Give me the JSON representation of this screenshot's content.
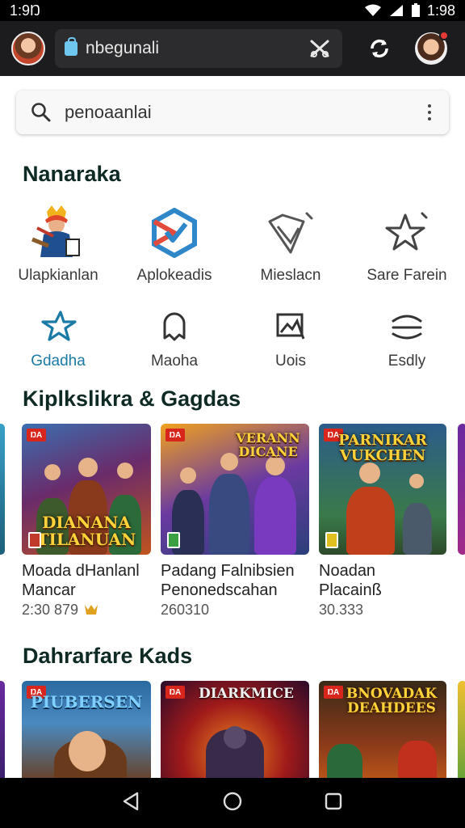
{
  "status": {
    "time": "1:9Ŋ",
    "time_right": "1:98"
  },
  "app_bar": {
    "search_text": "nbegunali",
    "close_icon": "close-icon",
    "sync_icon": "sync-icon"
  },
  "search": {
    "value": "penoaanlai"
  },
  "categories_section": {
    "title": "Nanaraka",
    "items": [
      {
        "label": "Ulapkianlan",
        "icon": "game-hero-icon"
      },
      {
        "label": "Aplokeadis",
        "icon": "apps-hex-icon"
      },
      {
        "label": "Mieslacn",
        "icon": "heart-tag-icon"
      },
      {
        "label": "Sare Farein",
        "icon": "star-icon"
      },
      {
        "label": "Gdadha",
        "icon": "plane-star-icon"
      },
      {
        "label": "Maoha",
        "icon": "ghost-icon"
      },
      {
        "label": "Uois",
        "icon": "image-frame-icon"
      },
      {
        "label": "Esdly",
        "icon": "waves-icon"
      }
    ]
  },
  "section1": {
    "title": "Kiplkslikra & Gagdas",
    "cards": [
      {
        "banner": "DIANANA\nTILANUAN",
        "line1": "Moada dHanlanl",
        "line2": "Mancar",
        "meta": "2:30 879",
        "badge": "ŊA",
        "has_award": true,
        "accent": "#7b2a1a"
      },
      {
        "banner": "VERANN\nDICANE",
        "line1": "Padang Falnibsien",
        "line2": "Penonedscahan",
        "meta": "260310",
        "badge": "ŊA",
        "has_award": false,
        "accent": "#4b2ea0"
      },
      {
        "banner": "PARNIKAR\nVUKCHEN",
        "line1": "Noadan",
        "line2": "Placainß",
        "meta": "30.333",
        "badge": "ŊA",
        "has_award": false,
        "accent": "#2b5c8a"
      }
    ]
  },
  "section2": {
    "title": "Dahrarfare Kads",
    "cards": [
      {
        "banner": "PIUBERSEN",
        "badge": "ŊA",
        "accent": "#1f5f8f"
      },
      {
        "banner": "DIARKMICE",
        "badge": "ŊA",
        "accent": "#6a1414"
      },
      {
        "banner": "BNOVADAK\nDEAHDEES",
        "badge": "ŊA",
        "accent": "#3a2a18"
      }
    ]
  },
  "nav": {
    "back": "back-icon",
    "home": "home-icon",
    "recents": "recents-icon"
  }
}
